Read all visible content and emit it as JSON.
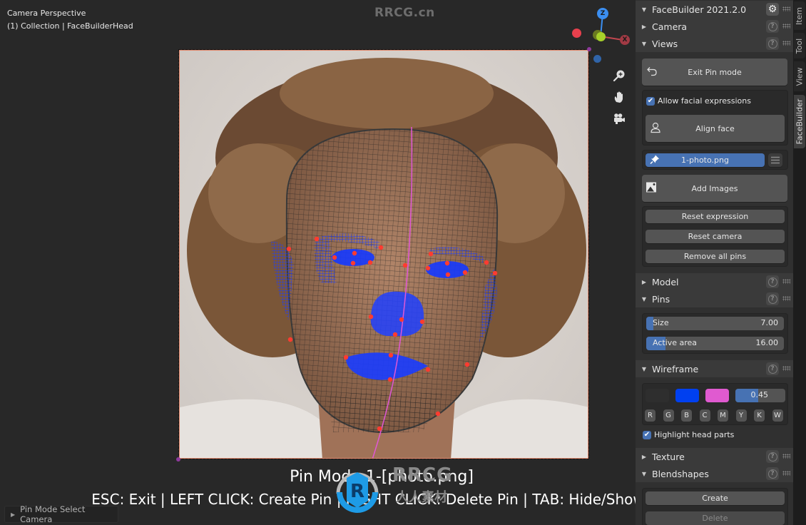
{
  "viewport": {
    "info_line1": "Camera Perspective",
    "info_line2": "(1) Collection | FaceBuilderHead",
    "watermark": "RRCG.cn",
    "gizmo": {
      "z": "Z",
      "x": "X",
      "y": "Y"
    },
    "nav_buttons": [
      {
        "icon": "zoom-icon",
        "glyph": "⊕"
      },
      {
        "icon": "hand-icon",
        "glyph": "✋"
      },
      {
        "icon": "camera-icon",
        "glyph": "🎥"
      }
    ],
    "overlay_title": "Pin Mode 1-[photo.png]",
    "overlay_help": "ESC: Exit | LEFT CLICK: Create Pin | RIGHT CLICK: Delete Pin | TAB: Hide/Show",
    "watermark_logo_text": "RRCG",
    "watermark_logo_sub": "人人素材",
    "last_operator": "Pin Mode Select Camera",
    "colors": {
      "wire_highlight": "#0a3cff",
      "pin": "#ff3b30",
      "midline": "#e057d6",
      "frame_border": "#e48a6e"
    }
  },
  "sidebar": {
    "header": {
      "title": "FaceBuilder 2021.2.0"
    },
    "panels": {
      "camera": "Camera",
      "views": "Views",
      "model": "Model",
      "pins": "Pins",
      "wireframe": "Wireframe",
      "texture": "Texture",
      "blendshapes": "Blendshapes"
    },
    "views": {
      "exit_pin_mode": "Exit Pin mode",
      "allow_facial_expressions": "Allow facial expressions",
      "allow_facial_expressions_checked": true,
      "align_face": "Align face",
      "current_image": "1-photo.png",
      "add_images": "Add Images",
      "reset_expression": "Reset expression",
      "reset_camera": "Reset camera",
      "remove_all_pins": "Remove all pins"
    },
    "pins": {
      "size_label": "Size",
      "size_value": "7.00",
      "size_fraction": 0.05,
      "active_area_label": "Active area",
      "active_area_value": "16.00",
      "active_area_fraction": 0.14
    },
    "wireframe": {
      "colors": [
        "#2e2e2e",
        "#0040f0",
        "#e05ad0"
      ],
      "opacity_value": "0.45",
      "opacity_fraction": 0.45,
      "channels": [
        "R",
        "G",
        "B",
        "C",
        "M",
        "Y",
        "K",
        "W"
      ],
      "highlight_head_parts": "Highlight head parts",
      "highlight_head_parts_checked": true
    },
    "blendshapes": {
      "create": "Create",
      "delete": "Delete"
    }
  },
  "tabs": [
    "Item",
    "Tool",
    "View",
    "FaceBuilder"
  ],
  "active_tab": "FaceBuilder"
}
